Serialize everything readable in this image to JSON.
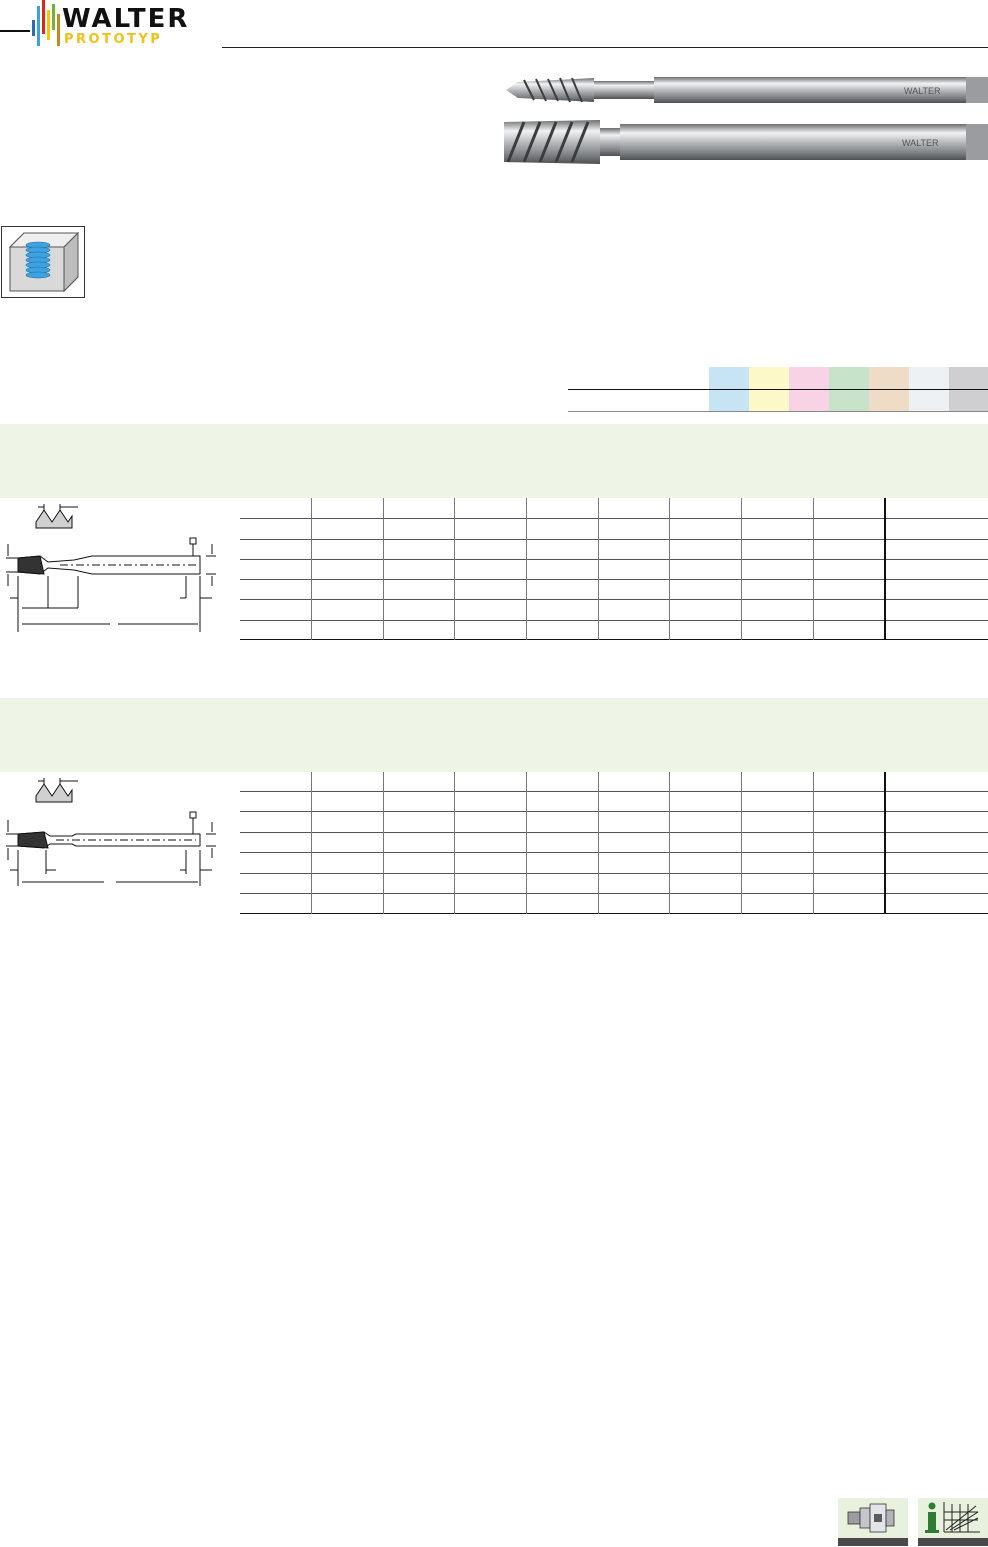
{
  "brand": {
    "name": "WALTER",
    "sub_brand": "PROTOTYP",
    "colors": [
      "#2a6db5",
      "#37a5dc",
      "#e2231a",
      "#f6c700",
      "#6fb43f",
      "#c58a1e"
    ]
  },
  "tool_photos": [
    {
      "name": "spiral-flute-tap-short",
      "shank_text": "WALTER"
    },
    {
      "name": "spiral-flute-tap-long",
      "shank_text": "WALTER"
    }
  ],
  "application_icon": "blind-hole-thread-icon",
  "material_strip": {
    "colors": [
      "#c6e4f4",
      "#fdf8c7",
      "#f7d3e5",
      "#c7e3c9",
      "#efdcc7",
      "#eef1f4",
      "#cfcfd1"
    ]
  },
  "sections": [
    {
      "id": "section-1",
      "rows": 6,
      "cols": 10
    },
    {
      "id": "section-2",
      "rows": 6,
      "cols": 10
    }
  ],
  "footer": {
    "buttons": [
      {
        "icon": "tool-holder-icon"
      },
      {
        "icon": "info-chart-icon"
      }
    ]
  }
}
